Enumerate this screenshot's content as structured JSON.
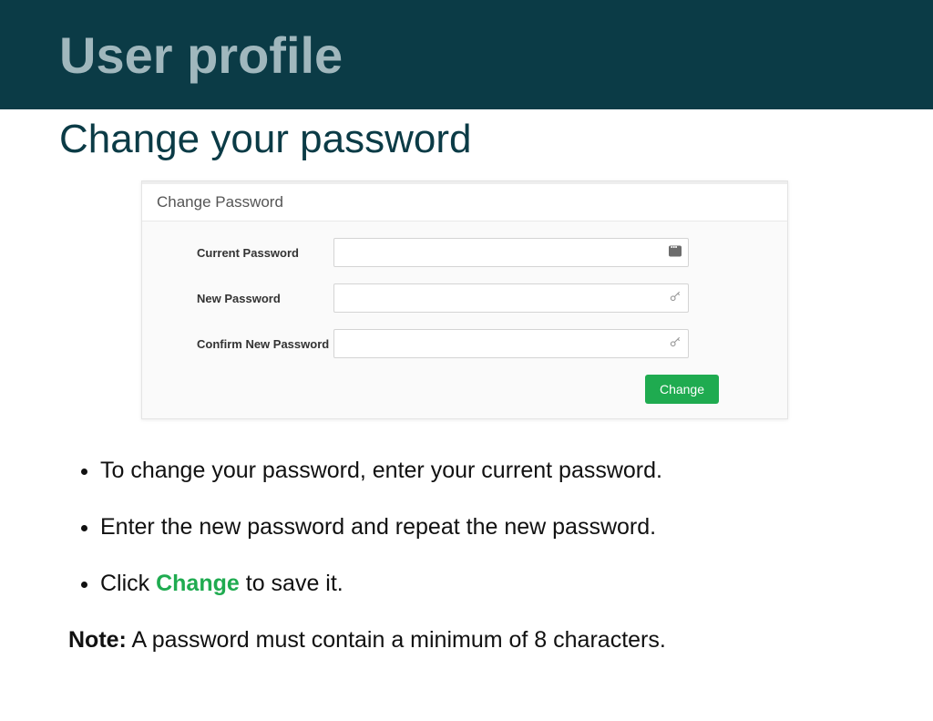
{
  "header": {
    "title": "User profile"
  },
  "subheader": {
    "title": "Change your password"
  },
  "panel": {
    "title": "Change Password",
    "fields": {
      "current": {
        "label": "Current Password",
        "value": ""
      },
      "new": {
        "label": "New Password",
        "value": ""
      },
      "confirm": {
        "label": "Confirm New Password",
        "value": ""
      }
    },
    "change_button": "Change"
  },
  "instructions": {
    "items": [
      "To change your password, enter your current password.",
      "Enter the new password and repeat the new password."
    ],
    "click_prefix": "Click ",
    "click_emph": "Change",
    "click_suffix": " to save it.",
    "note_label": "Note:",
    "note_text": " A password must contain a minimum of 8 characters."
  }
}
